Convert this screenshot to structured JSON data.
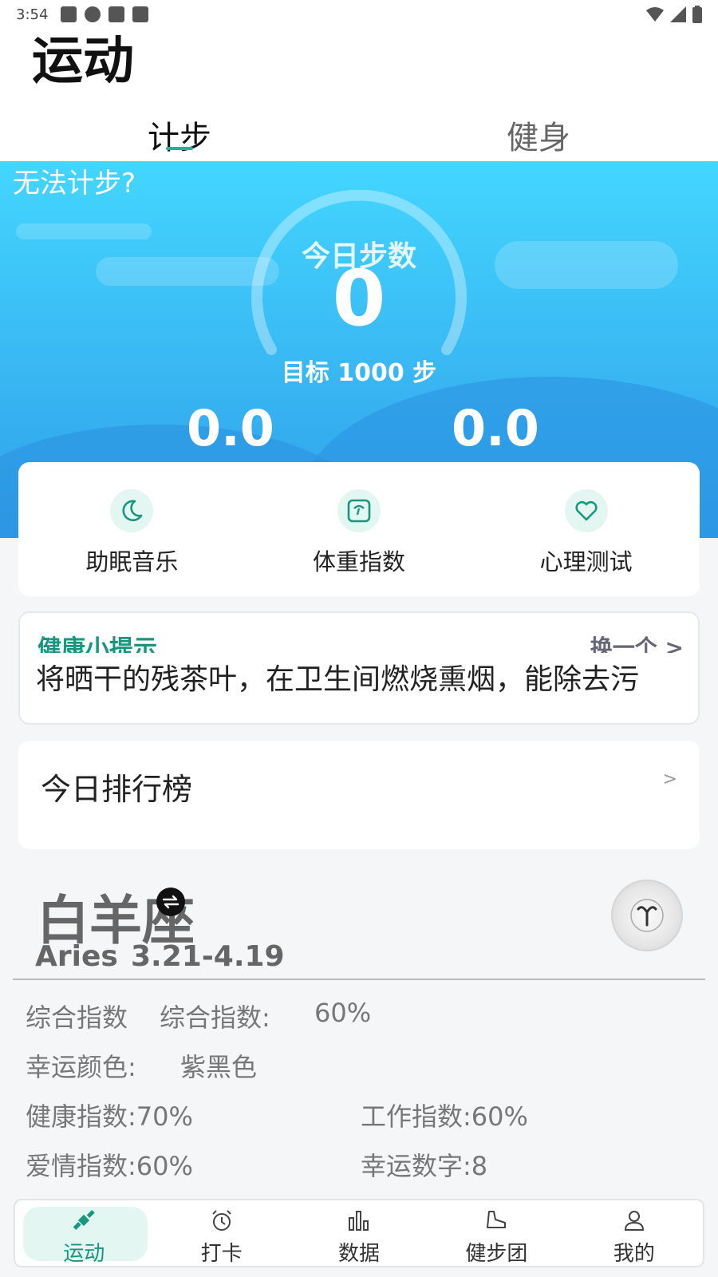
{
  "status_bar": {
    "time": "3:54"
  },
  "header": {
    "title": "运动"
  },
  "tabs": [
    {
      "label": "计步",
      "active": true
    },
    {
      "label": "健身",
      "active": false
    }
  ],
  "hero": {
    "cant_count_link": "无法计步?",
    "today_label": "今日步数",
    "steps": "0",
    "goal_text": "目标 1000 步",
    "stat_left": "0.0",
    "stat_right": "0.0"
  },
  "quick_actions": [
    {
      "label": "助眠音乐",
      "icon": "moon-icon"
    },
    {
      "label": "体重指数",
      "icon": "scale-icon"
    },
    {
      "label": "心理测试",
      "icon": "heart-icon"
    }
  ],
  "tip": {
    "title": "健康小提示",
    "next_label": "换一个 >",
    "text": "将晒干的残茶叶，在卫生间燃烧熏烟，能除去污"
  },
  "ranking": {
    "title": "今日排行榜",
    "arrow": ">"
  },
  "zodiac": {
    "name": "白羊座",
    "english": "Aries",
    "date_range": "3.21-4.19",
    "overall_label": "综合指数",
    "overall_text": "综合指数:",
    "overall_value": "60%",
    "lucky_color_label": "幸运颜色:",
    "lucky_color_value": "紫黑色",
    "health": "健康指数:70%",
    "work": "工作指数:60%",
    "love": "爱情指数:60%",
    "lucky_number": "幸运数字:8"
  },
  "bottom_nav": [
    {
      "label": "运动",
      "icon": "satellite-icon",
      "active": true
    },
    {
      "label": "打卡",
      "icon": "alarm-clock-icon",
      "active": false
    },
    {
      "label": "数据",
      "icon": "bar-chart-icon",
      "active": false
    },
    {
      "label": "健步团",
      "icon": "shoe-icon",
      "active": false
    },
    {
      "label": "我的",
      "icon": "user-icon",
      "active": false
    }
  ],
  "colors": {
    "accent": "#17977f",
    "hero_top": "#43d6ff",
    "hero_bottom": "#2f9fe8"
  }
}
